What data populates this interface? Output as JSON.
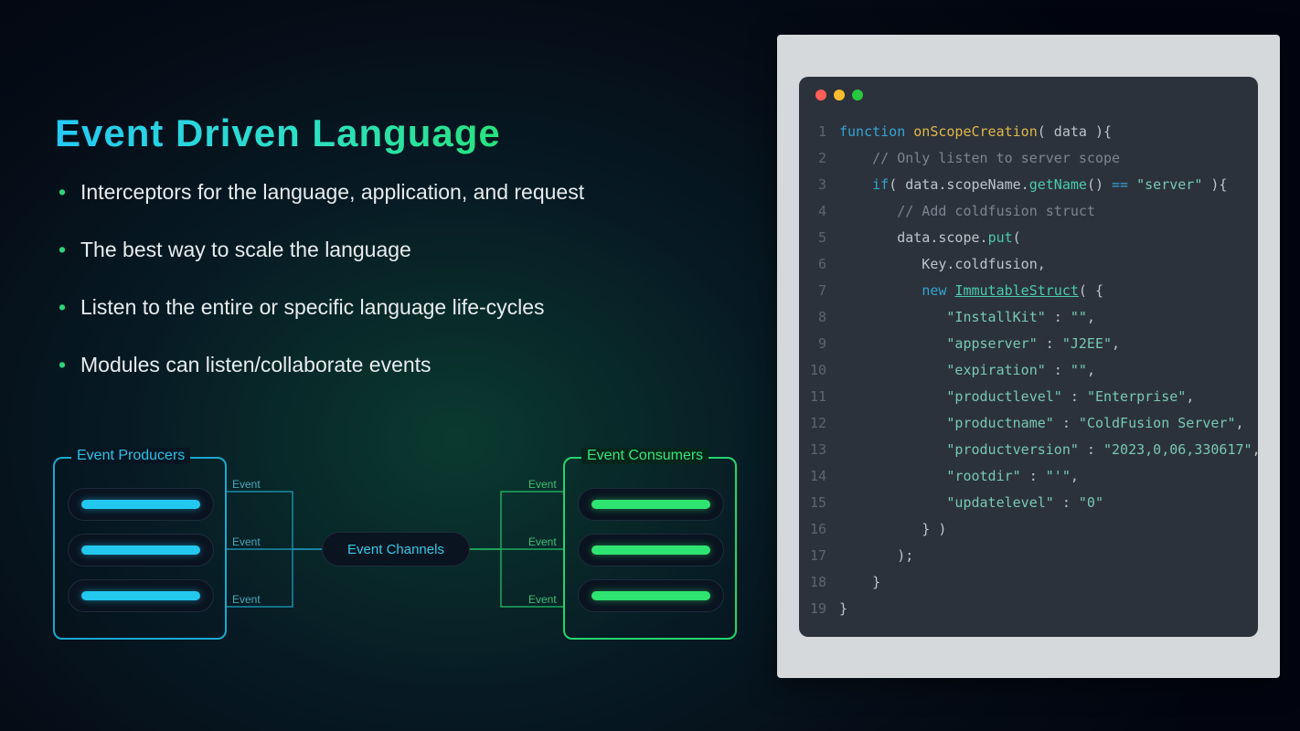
{
  "title": "Event Driven Language",
  "bullets": [
    "Interceptors for the language, application, and request",
    "The best way to scale the language",
    "Listen to the entire or specific language life-cycles",
    "Modules can listen/collaborate events"
  ],
  "diagram": {
    "producers_label": "Event Producers",
    "consumers_label": "Event Consumers",
    "channels_label": "Event Channels",
    "edge_label": "Event"
  },
  "code": {
    "lines": [
      [
        {
          "t": "function ",
          "c": "kw"
        },
        {
          "t": "onScopeCreation",
          "c": "fn"
        },
        {
          "t": "( data ){",
          "c": "op"
        }
      ],
      [
        {
          "t": "    ",
          "c": "op"
        },
        {
          "t": "// Only listen to server scope",
          "c": "cm"
        }
      ],
      [
        {
          "t": "    ",
          "c": "op"
        },
        {
          "t": "if",
          "c": "kw"
        },
        {
          "t": "( data.scopeName.",
          "c": "op"
        },
        {
          "t": "getName",
          "c": "pr"
        },
        {
          "t": "() ",
          "c": "op"
        },
        {
          "t": "==",
          "c": "kw"
        },
        {
          "t": " ",
          "c": "op"
        },
        {
          "t": "\"server\"",
          "c": "st"
        },
        {
          "t": " ){",
          "c": "op"
        }
      ],
      [
        {
          "t": "       ",
          "c": "op"
        },
        {
          "t": "// Add coldfusion struct",
          "c": "cm"
        }
      ],
      [
        {
          "t": "       data.scope.",
          "c": "op"
        },
        {
          "t": "put",
          "c": "pr"
        },
        {
          "t": "(",
          "c": "op"
        }
      ],
      [
        {
          "t": "          Key.coldfusion,",
          "c": "op"
        }
      ],
      [
        {
          "t": "          ",
          "c": "op"
        },
        {
          "t": "new ",
          "c": "kw"
        },
        {
          "t": "ImmutableStruct",
          "c": "pr underline"
        },
        {
          "t": "( {",
          "c": "op"
        }
      ],
      [
        {
          "t": "             ",
          "c": "op"
        },
        {
          "t": "\"InstallKit\"",
          "c": "st"
        },
        {
          "t": " : ",
          "c": "op"
        },
        {
          "t": "\"\"",
          "c": "st"
        },
        {
          "t": ",",
          "c": "op"
        }
      ],
      [
        {
          "t": "             ",
          "c": "op"
        },
        {
          "t": "\"appserver\"",
          "c": "st"
        },
        {
          "t": " : ",
          "c": "op"
        },
        {
          "t": "\"J2EE\"",
          "c": "st"
        },
        {
          "t": ",",
          "c": "op"
        }
      ],
      [
        {
          "t": "             ",
          "c": "op"
        },
        {
          "t": "\"expiration\"",
          "c": "st"
        },
        {
          "t": " : ",
          "c": "op"
        },
        {
          "t": "\"\"",
          "c": "st"
        },
        {
          "t": ",",
          "c": "op"
        }
      ],
      [
        {
          "t": "             ",
          "c": "op"
        },
        {
          "t": "\"productlevel\"",
          "c": "st"
        },
        {
          "t": " : ",
          "c": "op"
        },
        {
          "t": "\"Enterprise\"",
          "c": "st"
        },
        {
          "t": ",",
          "c": "op"
        }
      ],
      [
        {
          "t": "             ",
          "c": "op"
        },
        {
          "t": "\"productname\"",
          "c": "st"
        },
        {
          "t": " : ",
          "c": "op"
        },
        {
          "t": "\"ColdFusion Server\"",
          "c": "st"
        },
        {
          "t": ",",
          "c": "op"
        }
      ],
      [
        {
          "t": "             ",
          "c": "op"
        },
        {
          "t": "\"productversion\"",
          "c": "st"
        },
        {
          "t": " : ",
          "c": "op"
        },
        {
          "t": "\"2023,0,06,330617\"",
          "c": "st"
        },
        {
          "t": ",",
          "c": "op"
        }
      ],
      [
        {
          "t": "             ",
          "c": "op"
        },
        {
          "t": "\"rootdir\"",
          "c": "st"
        },
        {
          "t": " : ",
          "c": "op"
        },
        {
          "t": "\"'\"",
          "c": "st"
        },
        {
          "t": ",",
          "c": "op"
        }
      ],
      [
        {
          "t": "             ",
          "c": "op"
        },
        {
          "t": "\"updatelevel\"",
          "c": "st"
        },
        {
          "t": " : ",
          "c": "op"
        },
        {
          "t": "\"0\"",
          "c": "st"
        }
      ],
      [
        {
          "t": "          } )",
          "c": "op"
        }
      ],
      [
        {
          "t": "       );",
          "c": "op"
        }
      ],
      [
        {
          "t": "    }",
          "c": "op"
        }
      ],
      [
        {
          "t": "}",
          "c": "op"
        }
      ]
    ]
  }
}
